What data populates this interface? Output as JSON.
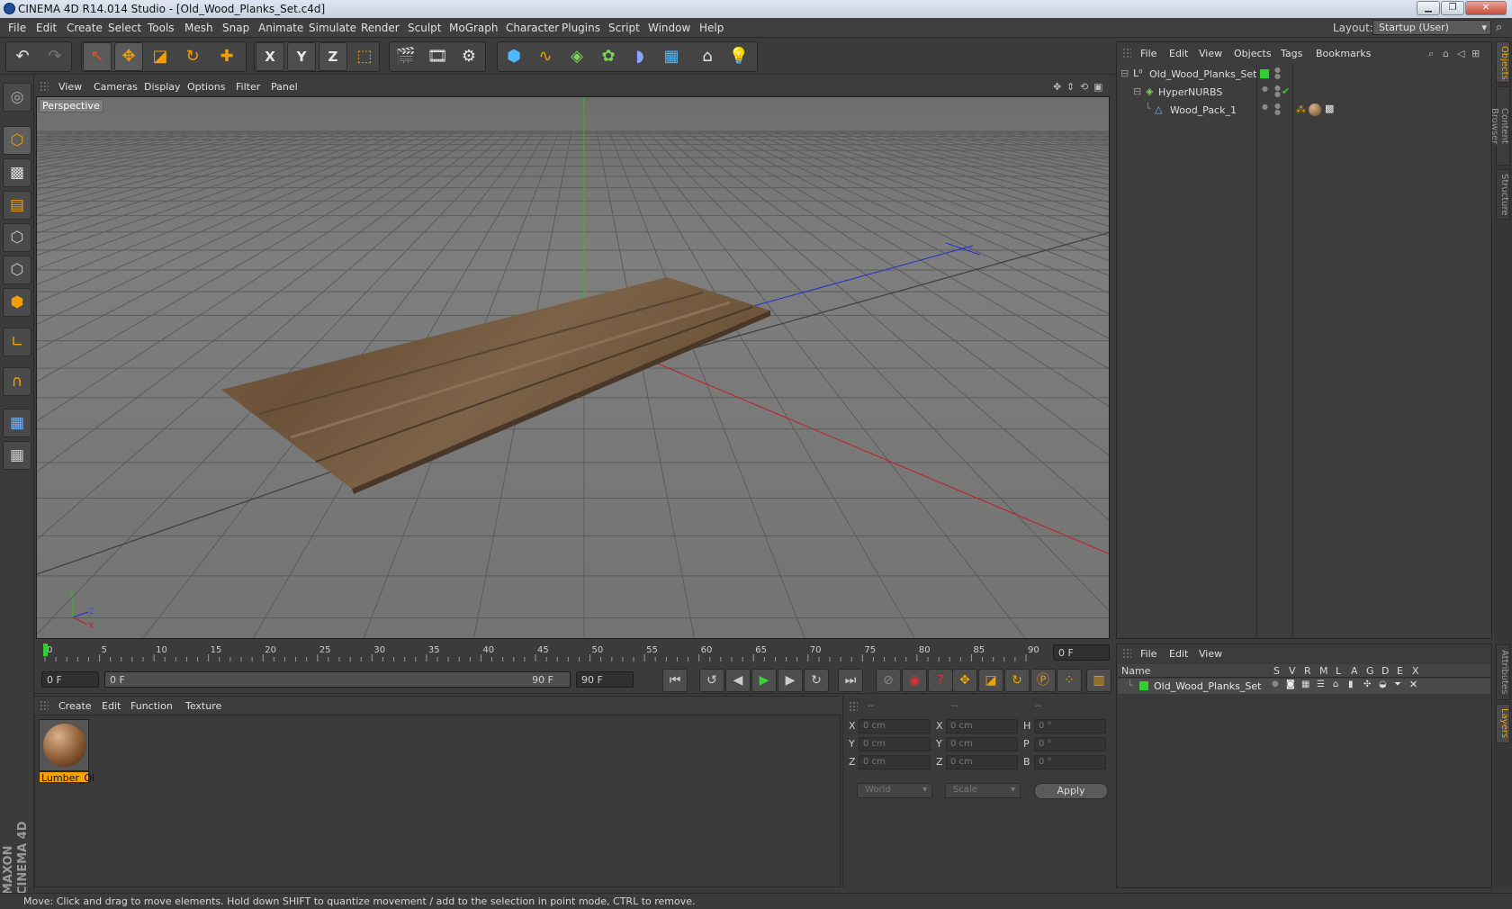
{
  "window": {
    "title": "CINEMA 4D R14.014 Studio - [Old_Wood_Planks_Set.c4d]",
    "minimize": "▁",
    "maximize": "❐",
    "close": "✕"
  },
  "menubar": {
    "items": [
      "File",
      "Edit",
      "Create",
      "Select",
      "Tools",
      "Mesh",
      "Snap",
      "Animate",
      "Simulate",
      "Render",
      "Sculpt",
      "MoGraph",
      "Character",
      "Plugins",
      "Script",
      "Window",
      "Help"
    ],
    "layout_label": "Layout:",
    "layout_value": "Startup (User)"
  },
  "toolbar": {
    "icons": [
      "undo-icon",
      "redo-icon",
      "live-selection-icon",
      "move-icon",
      "scale-icon",
      "rotate-icon",
      "add-icon",
      "x-axis-icon",
      "y-axis-icon",
      "z-axis-icon",
      "coordinate-system-icon",
      "render-view-icon",
      "render-picture-viewer-icon",
      "render-settings-icon",
      "cube-icon",
      "spline-icon",
      "nurbs-icon",
      "array-icon",
      "deformer-icon",
      "scene-floor-icon",
      "camera-icon",
      "light-icon"
    ],
    "axis_x": "X",
    "axis_y": "Y",
    "axis_z": "Z"
  },
  "left_tools": [
    "make-editable-icon",
    "model-mode-icon",
    "texture-mode-icon",
    "workplane-icon",
    "points-mode-icon",
    "edges-mode-icon",
    "polygons-mode-icon",
    "axis-mode-icon",
    "snap-icon",
    "locked-workplane-icon",
    "planar-workplane-icon"
  ],
  "brand": "MAXON CINEMA 4D",
  "viewport": {
    "menu": [
      "View",
      "Cameras",
      "Display",
      "Options",
      "Filter",
      "Panel"
    ],
    "label": "Perspective",
    "axis_y": "Y",
    "axis_z": "Z",
    "axis_x": "X"
  },
  "timeline": {
    "ticks": [
      "0",
      "5",
      "10",
      "15",
      "20",
      "25",
      "30",
      "35",
      "40",
      "45",
      "50",
      "55",
      "60",
      "65",
      "70",
      "75",
      "80",
      "85",
      "90"
    ],
    "current_frame": "0 F"
  },
  "transport": {
    "start_field": "0 F",
    "range_start": "0 F",
    "range_end": "90 F",
    "end_field": "90 F"
  },
  "material_manager": {
    "menu": [
      "Create",
      "Edit",
      "Function",
      "Texture"
    ],
    "materials": [
      {
        "name": "Lumber_Ol"
      }
    ]
  },
  "coordinates": {
    "headers": [
      "--",
      "--",
      "--"
    ],
    "rows": [
      {
        "l1": "X",
        "v1": "0 cm",
        "l2": "X",
        "v2": "0 cm",
        "l3": "H",
        "v3": "0 °"
      },
      {
        "l1": "Y",
        "v1": "0 cm",
        "l2": "Y",
        "v2": "0 cm",
        "l3": "P",
        "v3": "0 °"
      },
      {
        "l1": "Z",
        "v1": "0 cm",
        "l2": "Z",
        "v2": "0 cm",
        "l3": "B",
        "v3": "0 °"
      }
    ],
    "space": "World",
    "mode": "Scale",
    "apply": "Apply"
  },
  "object_manager": {
    "menu": [
      "File",
      "Edit",
      "View",
      "Objects",
      "Tags",
      "Bookmarks"
    ],
    "objects": [
      {
        "name": "Old_Wood_Planks_Set",
        "indent": 0,
        "color": "#2fd12f"
      },
      {
        "name": "HyperNURBS",
        "indent": 1,
        "color": ""
      },
      {
        "name": "Wood_Pack_1",
        "indent": 2,
        "color": ""
      }
    ]
  },
  "layer_manager": {
    "menu": [
      "File",
      "Edit",
      "View"
    ],
    "columns": [
      "Name",
      "S",
      "V",
      "R",
      "M",
      "L",
      "A",
      "G",
      "D",
      "E",
      "X"
    ],
    "layers": [
      {
        "name": "Old_Wood_Planks_Set",
        "color": "#2fd12f"
      }
    ]
  },
  "side_tabs": [
    "Objects",
    "Content Browser",
    "Structure",
    "Attributes",
    "Layers"
  ],
  "status": "Move: Click and drag to move elements. Hold down SHIFT to quantize movement / add to the selection in point mode, CTRL to remove.",
  "colors": {
    "accent": "#f0a000",
    "bg": "#3b3b3b",
    "y_axis": "#1fc41f",
    "x_axis": "#d02020",
    "z_axis": "#2030d0"
  }
}
